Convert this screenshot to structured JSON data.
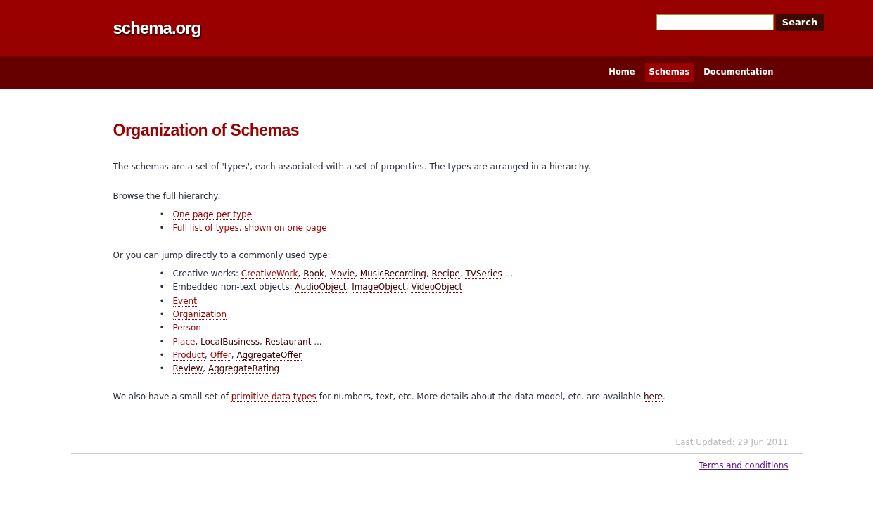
{
  "header": {
    "logo": "schema.org",
    "search": {
      "button": "Search"
    }
  },
  "nav": [
    {
      "label": "Home",
      "selected": false
    },
    {
      "label": "Schemas",
      "selected": true
    },
    {
      "label": "Documentation",
      "selected": false
    }
  ],
  "title": "Organization of Schemas",
  "intro": "The schemas are a set of 'types', each associated with a set of properties. The types are arranged in a hierarchy.",
  "browse_label": "Browse the full hierarchy:",
  "bullet": "•",
  "browse_items": [
    [
      {
        "link": "One page per type",
        "visited": false
      }
    ],
    [
      {
        "link": "Full list of types, shown on one page",
        "visited": false
      }
    ]
  ],
  "jump_label": "Or you can jump directly to a commonly used type:",
  "jump_items": [
    [
      {
        "text": "Creative works: "
      },
      {
        "link": "CreativeWork",
        "visited": false
      },
      {
        "text": ", "
      },
      {
        "link": "Book",
        "visited": true
      },
      {
        "text": ", "
      },
      {
        "link": "Movie",
        "visited": true
      },
      {
        "text": ", "
      },
      {
        "link": "MusicRecording",
        "visited": true
      },
      {
        "text": ", "
      },
      {
        "link": "Recipe",
        "visited": true
      },
      {
        "text": ", "
      },
      {
        "link": "TVSeries",
        "visited": true
      },
      {
        "text": " ..."
      }
    ],
    [
      {
        "text": "Embedded non-text objects: "
      },
      {
        "link": "AudioObject",
        "visited": true
      },
      {
        "text": ", "
      },
      {
        "link": "ImageObject",
        "visited": true
      },
      {
        "text": ", "
      },
      {
        "link": "VideoObject",
        "visited": true
      }
    ],
    [
      {
        "link": "Event",
        "visited": false
      }
    ],
    [
      {
        "link": "Organization",
        "visited": false
      }
    ],
    [
      {
        "link": "Person",
        "visited": false
      }
    ],
    [
      {
        "link": "Place",
        "visited": false
      },
      {
        "text": ", "
      },
      {
        "link": "LocalBusiness",
        "visited": true
      },
      {
        "text": ", "
      },
      {
        "link": "Restaurant",
        "visited": true
      },
      {
        "text": " ..."
      }
    ],
    [
      {
        "link": "Product",
        "visited": false
      },
      {
        "text": ", "
      },
      {
        "link": "Offer",
        "visited": false
      },
      {
        "text": ", "
      },
      {
        "link": "AggregateOffer",
        "visited": true
      }
    ],
    [
      {
        "link": "Review",
        "visited": true
      },
      {
        "text": ", "
      },
      {
        "link": "AggregateRating",
        "visited": true
      }
    ]
  ],
  "closing": [
    {
      "text": "We also have a small set of "
    },
    {
      "link": "primitive data types",
      "visited": false
    },
    {
      "text": " for numbers, text, etc. More details about the data model, etc. are available "
    },
    {
      "link": "here",
      "visited": true
    },
    {
      "text": "."
    }
  ],
  "footer": {
    "updated": "Last Updated: 29 Jun 2011",
    "terms": "Terms and conditions"
  }
}
